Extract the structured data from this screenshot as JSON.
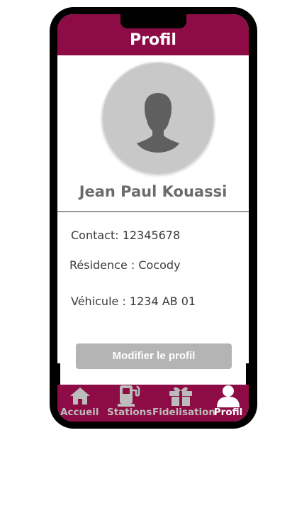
{
  "header": {
    "title": "Profil"
  },
  "profile": {
    "name": "Jean Paul Kouassi",
    "contact": "Contact: 12345678",
    "residence": "Résidence : Cocody",
    "vehicle": "Véhicule : 1234 AB 01"
  },
  "actions": {
    "edit_label": "Modifier le profil"
  },
  "nav": {
    "items": [
      {
        "label": "Accueil",
        "icon": "home-icon",
        "active": false
      },
      {
        "label": "Stations",
        "icon": "fuel-station-icon",
        "active": false
      },
      {
        "label": "Fidelisation",
        "icon": "gift-icon",
        "active": false
      },
      {
        "label": "Profil",
        "icon": "user-icon",
        "active": true
      }
    ]
  },
  "colors": {
    "brand": "#8d0c45",
    "nav_inactive": "#bcbcbc",
    "nav_active": "#ffffff",
    "button_disabled": "#b4b4b4",
    "name_text": "#6b6b6b"
  }
}
